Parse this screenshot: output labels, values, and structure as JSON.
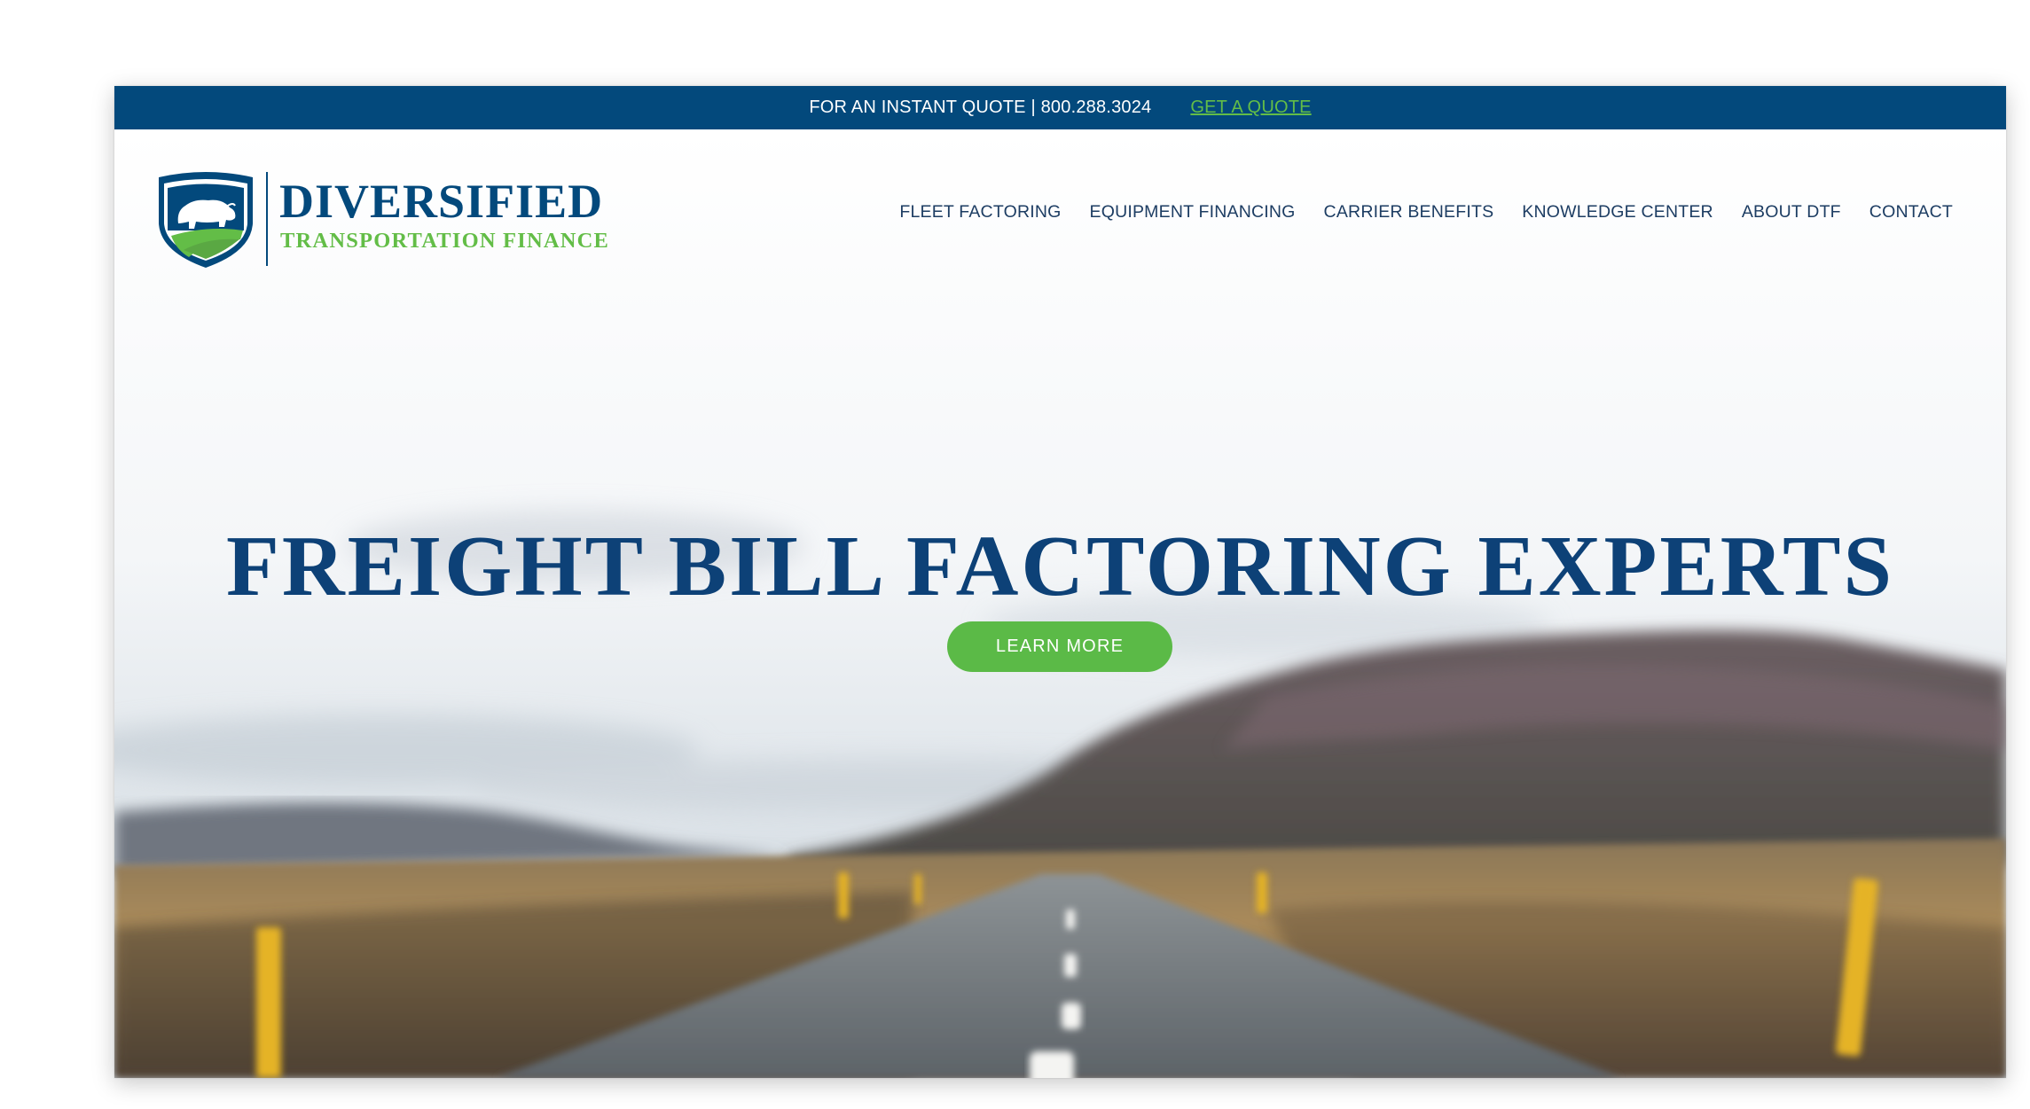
{
  "topbar": {
    "quote_text": "FOR AN INSTANT QUOTE | 800.288.3024",
    "quote_link": "GET A QUOTE"
  },
  "brand": {
    "name_top": "DIVERSIFIED",
    "name_bottom": "TRANSPORTATION FINANCE",
    "logo_icon": "bison-shield-icon"
  },
  "nav": {
    "items": [
      {
        "label": "FLEET FACTORING"
      },
      {
        "label": "EQUIPMENT FINANCING"
      },
      {
        "label": "CARRIER BENEFITS"
      },
      {
        "label": "KNOWLEDGE CENTER"
      },
      {
        "label": "ABOUT DTF"
      },
      {
        "label": "CONTACT"
      }
    ]
  },
  "hero": {
    "headline": "FREIGHT BILL FACTORING EXPERTS",
    "cta_label": "LEARN MORE"
  },
  "colors": {
    "brand_blue": "#03497c",
    "brand_green": "#63bd47",
    "headline_blue": "#0d4177"
  }
}
